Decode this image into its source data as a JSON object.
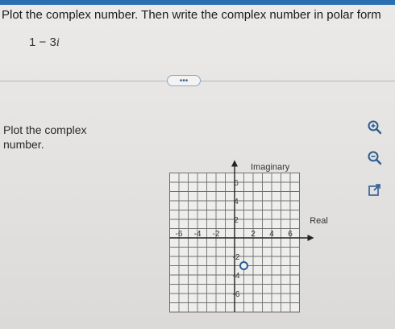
{
  "question": {
    "text": "Plot the complex number. Then write the complex number in polar form"
  },
  "expression": {
    "real": "1",
    "op": "−",
    "coef": "3",
    "unit": "i"
  },
  "more_button": {
    "label": "•••"
  },
  "instruction": {
    "text": "Plot the complex number."
  },
  "graph": {
    "imag_label": "Imaginary",
    "real_label": "Real",
    "x_ticks": [
      "-6",
      "-4",
      "-2",
      "2",
      "4",
      "6"
    ],
    "y_ticks": [
      "6",
      "4",
      "2",
      "-2",
      "-4",
      "-6"
    ],
    "point": {
      "re": 1,
      "im": -3
    },
    "accent": "#2a5d93"
  },
  "tools": [
    {
      "name": "zoom-in-icon"
    },
    {
      "name": "zoom-out-icon"
    },
    {
      "name": "expand-icon"
    }
  ]
}
